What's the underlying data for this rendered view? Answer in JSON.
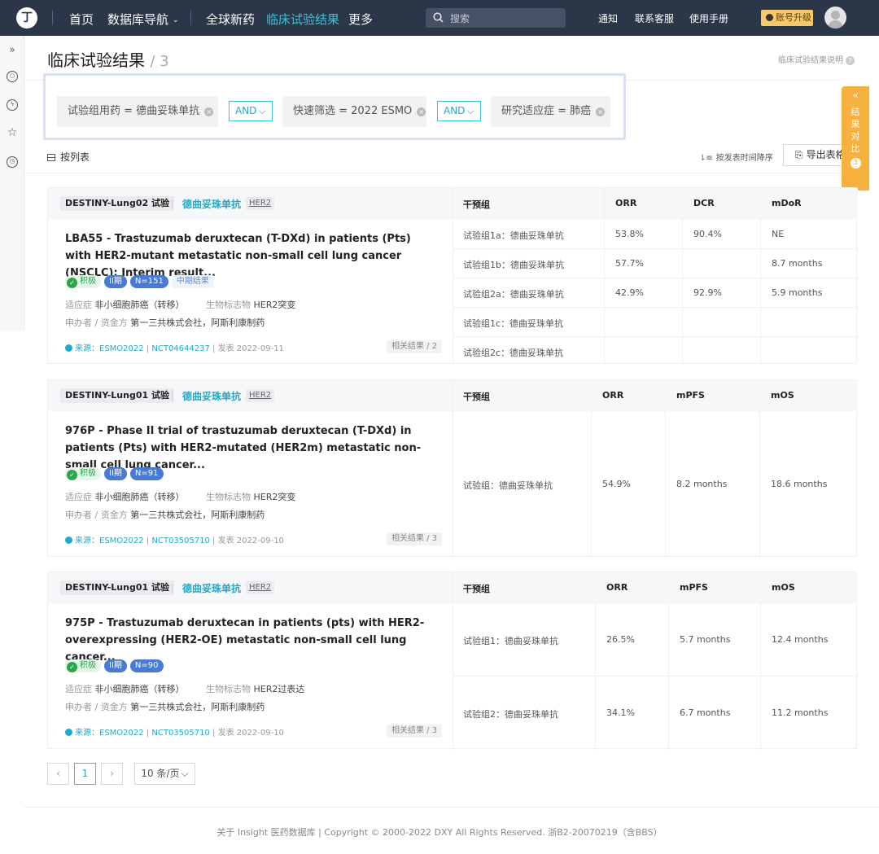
{
  "topbar": {
    "logo": "丁",
    "nav": [
      "首页",
      "数据库导航",
      "全球新药",
      "临床试验结果",
      "更多"
    ],
    "search_placeholder": "搜索",
    "links": [
      "通知",
      "联系客服",
      "使用手册"
    ],
    "upgrade": "账号升级"
  },
  "page": {
    "title": "临床试验结果",
    "count": "/ 3",
    "help": "临床试验结果说明",
    "help_icon": "?"
  },
  "filters": {
    "chip1": "试验组用药 = 德曲妥珠单抗",
    "and1": "AND",
    "chip2": "快速筛选 = 2022 ESMO",
    "and2": "AND",
    "chip3": "研究适应症 = 肺癌",
    "remove_icon": "×"
  },
  "toolbar": {
    "list_view": "按列表",
    "sort": "按发表时间降序",
    "export": "导出表格"
  },
  "compare": {
    "chev": "«",
    "label": "结果对比",
    "count": "3"
  },
  "labels": {
    "indication": "适应症",
    "biomarker": "生物标志物",
    "sponsor": "申办者 / 资金方",
    "source_prefix": "来源：",
    "published": "发表",
    "pipe": "|"
  },
  "cards": [
    {
      "trial": "DESTINY-Lung02 试验",
      "drug": "德曲妥珠单抗",
      "gene": "HER2",
      "title": "LBA55 - Trastuzumab deruxtecan (T-DXd) in patients (Pts) with HER2-mutant metastatic non-small cell lung cancer (NSCLC): Interim result...",
      "badges": {
        "status": "积极",
        "phase": "II期",
        "n": "N=151",
        "extra": "中期结果"
      },
      "indication": "非小细胞肺癌（转移）",
      "biomarker": "HER2突变",
      "sponsor": "第一三共株式会社，阿斯利康制药",
      "source": "ESMO2022",
      "nct": "NCT04644237",
      "date": "2022-09-11",
      "related": "相关结果 / 2",
      "headers": [
        "干预组",
        "ORR",
        "DCR",
        "mDoR"
      ],
      "rows": [
        [
          "试验组1a：德曲妥珠单抗",
          "53.8%",
          "90.4%",
          "NE"
        ],
        [
          "试验组1b：德曲妥珠单抗",
          "57.7%",
          "",
          "8.7 months"
        ],
        [
          "试验组2a：德曲妥珠单抗",
          "42.9%",
          "92.9%",
          "5.9 months"
        ],
        [
          "试验组1c：德曲妥珠单抗",
          "",
          "",
          ""
        ],
        [
          "试验组2c：德曲妥珠单抗",
          "",
          "",
          ""
        ]
      ]
    },
    {
      "trial": "DESTINY-Lung01 试验",
      "drug": "德曲妥珠单抗",
      "gene": "HER2",
      "title": "976P - Phase II trial of trastuzumab deruxtecan (T-DXd) in patients (Pts) with HER2-mutated (HER2m) metastatic non-small cell lung cancer...",
      "badges": {
        "status": "积极",
        "phase": "II期",
        "n": "N=91"
      },
      "indication": "非小细胞肺癌（转移）",
      "biomarker": "HER2突变",
      "sponsor": "第一三共株式会社，阿斯利康制药",
      "source": "ESMO2022",
      "nct": "NCT03505710",
      "date": "2022-09-10",
      "related": "相关结果 / 3",
      "headers": [
        "干预组",
        "ORR",
        "mPFS",
        "mOS"
      ],
      "rows": [
        [
          "试验组：德曲妥珠单抗",
          "54.9%",
          "8.2 months",
          "18.6 months"
        ]
      ]
    },
    {
      "trial": "DESTINY-Lung01 试验",
      "drug": "德曲妥珠单抗",
      "gene": "HER2",
      "title": "975P - Trastuzumab deruxtecan in patients (pts) with HER2-overexpressing (HER2-OE) metastatic non-small cell lung cancer...",
      "badges": {
        "status": "积极",
        "phase": "II期",
        "n": "N=90"
      },
      "indication": "非小细胞肺癌（转移）",
      "biomarker": "HER2过表达",
      "sponsor": "第一三共株式会社，阿斯利康制药",
      "source": "ESMO2022",
      "nct": "NCT03505710",
      "date": "2022-09-10",
      "related": "相关结果 / 3",
      "headers": [
        "干预组",
        "ORR",
        "mPFS",
        "mOS"
      ],
      "rows": [
        [
          "试验组1：德曲妥珠单抗",
          "26.5%",
          "5.7 months",
          "12.4 months"
        ],
        [
          "试验组2：德曲妥珠单抗",
          "34.1%",
          "6.7 months",
          "11.2 months"
        ]
      ]
    }
  ],
  "pagination": {
    "prev": "‹",
    "page": "1",
    "next": "›",
    "per_page": "10 条/页"
  },
  "footer": "关于 Insight 医药数据库  |  Copyright © 2000-2022 DXY All Rights Reserved. 浙B2-20070219（含BBS）"
}
